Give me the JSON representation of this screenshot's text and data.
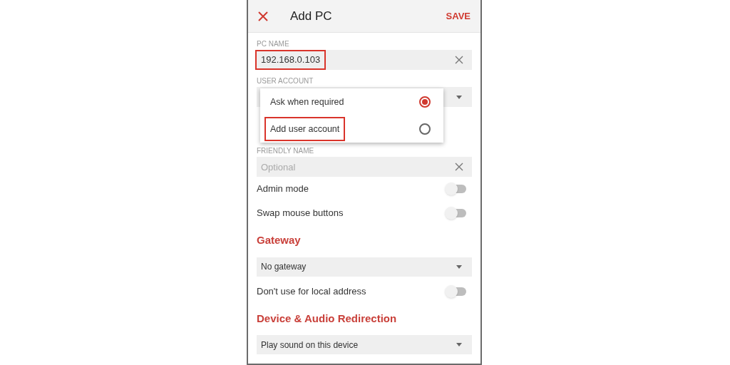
{
  "header": {
    "title": "Add PC",
    "action": "SAVE"
  },
  "pc_name": {
    "label": "PC NAME",
    "value": "192.168.0.103",
    "highlighted": true
  },
  "user_account": {
    "label": "USER ACCOUNT"
  },
  "user_account_menu": [
    {
      "label": "Ask when required",
      "selected": true,
      "highlighted": false
    },
    {
      "label": "Add user account",
      "selected": false,
      "highlighted": true
    }
  ],
  "friendly_name": {
    "label": "FRIENDLY NAME",
    "placeholder": "Optional"
  },
  "settings": [
    {
      "kind": "toggle",
      "label": "Admin mode",
      "on": false
    },
    {
      "kind": "toggle",
      "label": "Swap mouse buttons",
      "on": false
    },
    {
      "kind": "heading",
      "label": "Gateway"
    },
    {
      "kind": "dropdown",
      "value": "No gateway"
    },
    {
      "kind": "toggle",
      "label": "Don't use for local address",
      "on": false
    },
    {
      "kind": "heading",
      "label": "Device & Audio Redirection"
    },
    {
      "kind": "dropdown",
      "value": "Play sound on this device"
    }
  ]
}
